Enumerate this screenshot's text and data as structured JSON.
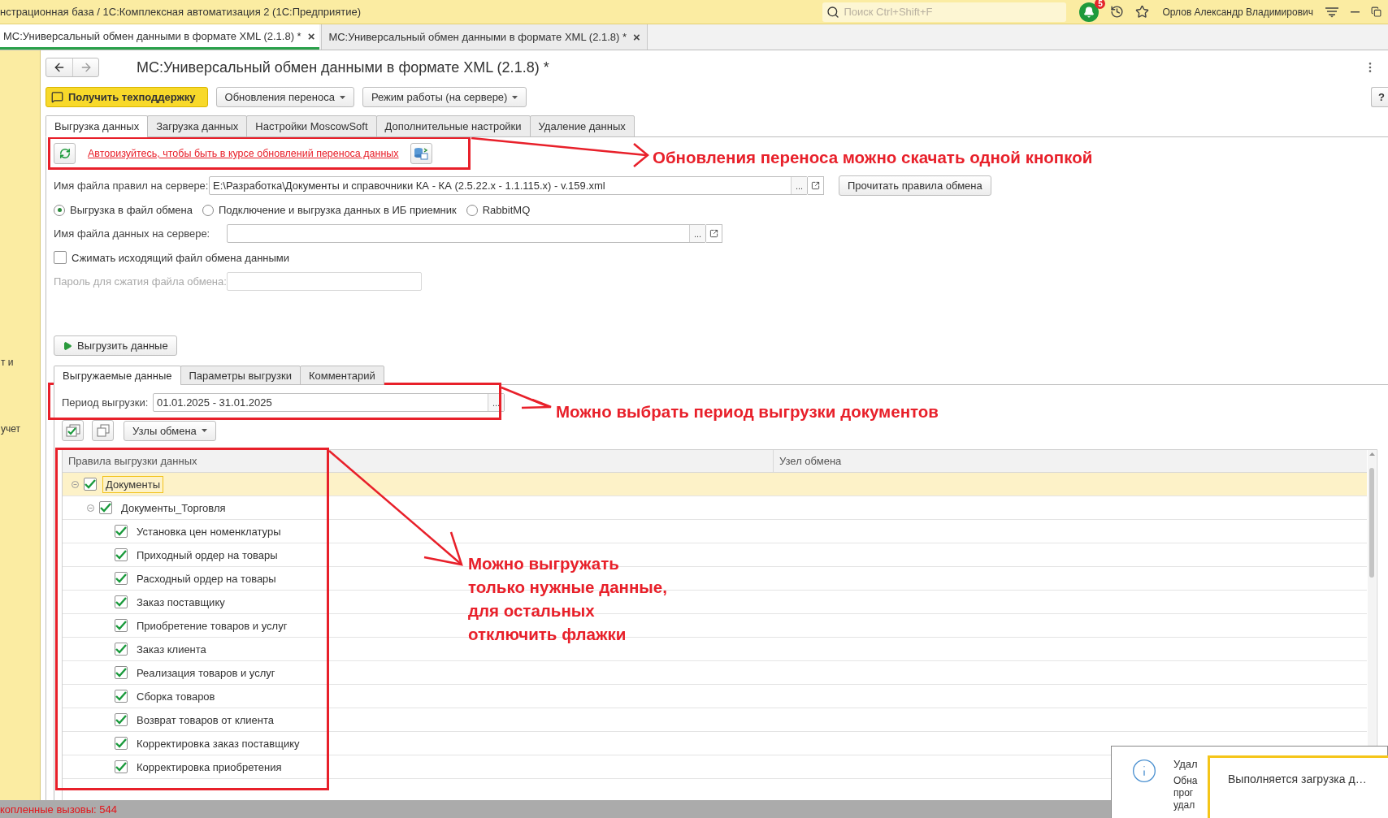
{
  "title_bar": {
    "title": "нстрационная база / 1С:Комплексная автоматизация 2  (1С:Предприятие)",
    "search": {
      "placeholder": "Поиск Ctrl+Shift+F"
    },
    "notification_count": "5",
    "user": "Орлов Александр Владимирович"
  },
  "open_tabs": [
    {
      "label": "МС:Универсальный обмен данными в формате XML (2.1.8) *",
      "close": "×",
      "selected": true
    },
    {
      "label": "МС:Универсальный обмен данными в формате XML (2.1.8) *",
      "close": "×",
      "selected": false
    }
  ],
  "sidebar": {
    "items": [
      "т и",
      "учет"
    ]
  },
  "form": {
    "title": "МС:Универсальный обмен данными в формате XML (2.1.8) *",
    "buttons": [
      {
        "label": "Получить техподдержку",
        "kind": "primary"
      },
      {
        "label": "Обновления переноса",
        "kind": "dropdown"
      },
      {
        "label": "Режим работы (на сервере)",
        "kind": "dropdown"
      }
    ],
    "help": "?",
    "tabs": [
      {
        "label": "Выгрузка данных",
        "selected": true
      },
      {
        "label": "Загрузка данных",
        "selected": false
      },
      {
        "label": "Настройки MoscowSoft",
        "selected": false
      },
      {
        "label": "Дополнительные настройки",
        "selected": false
      },
      {
        "label": "Удаление данных",
        "selected": false
      }
    ],
    "auth_link": "Авторизуйтесь, чтобы быть в курсе обновлений переноса данных",
    "rules_file": {
      "label": "Имя файла правил на сервере:",
      "value": "E:\\Разработка\\Документы и справочники КА - КА (2.5.22.x - 1.1.115.x) - v.159.xml",
      "choose": "..."
    },
    "read_rules_button": "Прочитать правила обмена",
    "export_modes": [
      {
        "label": "Выгрузка в файл обмена",
        "selected": true
      },
      {
        "label": "Подключение и выгрузка данных в ИБ приемник",
        "selected": false
      },
      {
        "label": "RabbitMQ",
        "selected": false
      }
    ],
    "data_file": {
      "label": "Имя файла данных на сервере:",
      "choose": "..."
    },
    "compress": {
      "label": "Сжимать исходящий файл обмена данными",
      "checked": false
    },
    "password": {
      "label": "Пароль для сжатия файла обмена:",
      "disabled": true
    },
    "export_button": "Выгрузить данные",
    "sub_tabs": [
      {
        "label": "Выгружаемые данные",
        "selected": true
      },
      {
        "label": "Параметры выгрузки",
        "selected": false
      },
      {
        "label": "Комментарий",
        "selected": false
      }
    ],
    "period": {
      "label": "Период выгрузки:",
      "value": "01.01.2025 - 31.01.2025",
      "choose": "..."
    },
    "nodes_button": "Узлы обмена",
    "table": {
      "columns": [
        "Правила выгрузки данных",
        "Узел обмена"
      ],
      "rows": [
        {
          "label": "Документы",
          "checked": true,
          "expanded": true,
          "selected": true,
          "children": [
            {
              "label": "Документы_Торговля",
              "checked": true,
              "expanded": true,
              "selected": false,
              "children": [
                {
                  "label": "Установка цен номенклатуры",
                  "checked": true,
                  "selected": false
                },
                {
                  "label": "Приходный ордер на товары",
                  "checked": true,
                  "selected": false
                },
                {
                  "label": "Расходный ордер на товары",
                  "checked": true,
                  "selected": false
                },
                {
                  "label": "Заказ поставщику",
                  "checked": true,
                  "selected": false
                },
                {
                  "label": "Приобретение товаров и услуг",
                  "checked": true,
                  "selected": false
                },
                {
                  "label": "Заказ клиента",
                  "checked": true,
                  "selected": false
                },
                {
                  "label": "Реализация товаров и услуг",
                  "checked": true,
                  "selected": false
                },
                {
                  "label": "Сборка товаров",
                  "checked": true,
                  "selected": false
                },
                {
                  "label": "Возврат товаров от клиента",
                  "checked": true,
                  "selected": false
                },
                {
                  "label": "Корректировка заказ поставщику",
                  "checked": true,
                  "selected": false
                },
                {
                  "label": "Корректировка приобретения",
                  "checked": true,
                  "selected": false
                }
              ]
            }
          ]
        }
      ]
    }
  },
  "annotations": [
    {
      "lines": [
        "Обновления переноса можно скачать одной кнопкой"
      ]
    },
    {
      "lines": [
        "Можно выбрать период выгрузки документов"
      ]
    },
    {
      "lines": [
        "Можно выгружать",
        "только нужные данные,",
        "для остальных",
        "отключить флажки"
      ]
    }
  ],
  "status_bar": {
    "text": "копленные вызовы: 544"
  },
  "notifications": {
    "info_lines": [
      "Удал",
      "Обна",
      "прог",
      "удал"
    ],
    "progress": "Выполняется загрузка д…"
  }
}
